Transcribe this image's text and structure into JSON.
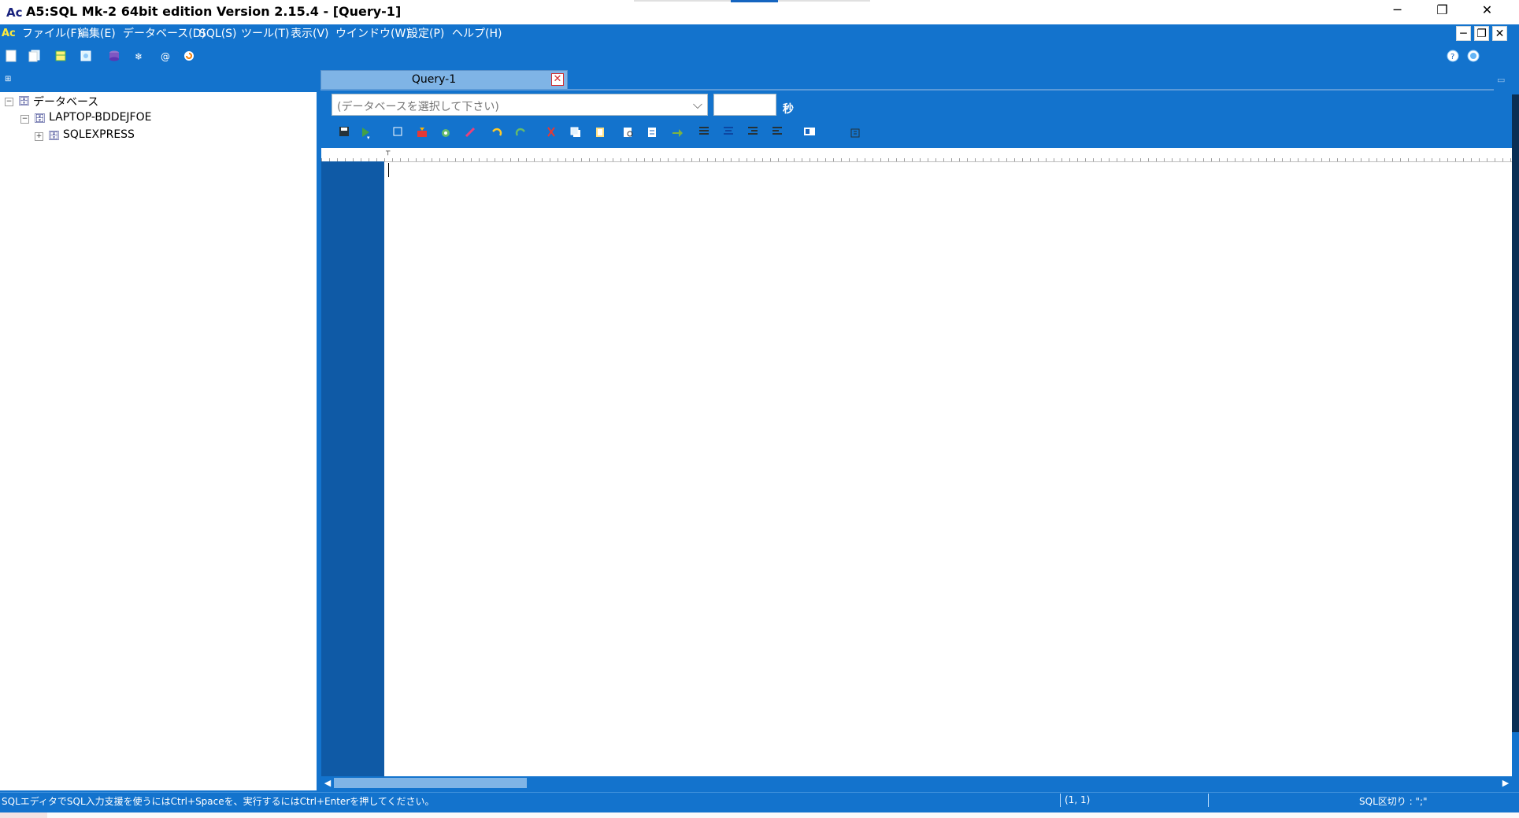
{
  "window": {
    "title": "A5:SQL Mk-2 64bit edition Version 2.15.4 - [Query-1]",
    "app_icon": "Ac",
    "controls": {
      "minimize": "─",
      "maximize": "❐",
      "close": "✕"
    }
  },
  "menu": {
    "items": [
      "ファイル(F)",
      "編集(E)",
      "データベース(D)",
      "SQL(S)",
      "ツール(T)",
      "表示(V)",
      "ウインドウ(W)",
      "設定(P)",
      "ヘルプ(H)"
    ],
    "mdi_controls": {
      "minimize": "─",
      "restore": "❐",
      "close": "✕"
    }
  },
  "toolbar": {
    "icons": [
      "new-file-icon",
      "open-file-icon",
      "table-icon",
      "copy-db-icon",
      "database-icon",
      "snowflake-icon",
      "at-sign-icon",
      "refresh-icon"
    ],
    "help_icons": [
      "help-icon",
      "web-icon"
    ]
  },
  "explorer": {
    "root": {
      "label": "データベース",
      "expander": "−"
    },
    "server": {
      "label": "LAPTOP-BDDEJFOE",
      "expander": "−"
    },
    "instance": {
      "label": "SQLEXPRESS",
      "expander": "+"
    }
  },
  "tabs": [
    {
      "label": "Query-1",
      "close": "✕"
    }
  ],
  "query_bar": {
    "db_placeholder": "(データベースを選択して下さい)",
    "timeout_value": "",
    "seconds_label": "秒"
  },
  "editor_toolbar": {
    "icons": [
      "save-icon",
      "run-icon",
      "stop-icon",
      "explain-icon",
      "format-icon",
      "clear-icon",
      "undo-icon",
      "redo-icon",
      "cut-icon",
      "copy-icon",
      "paste-icon",
      "find-icon",
      "replace-icon",
      "goto-icon",
      "align-left-icon",
      "align-center-icon",
      "indent-icon",
      "outdent-icon",
      "window-icon",
      "options-icon"
    ]
  },
  "statusbar": {
    "message": "SQLエディタでSQL入力支援を使うにはCtrl+Spaceを、実行するにはCtrl+Enterを押してください。",
    "cursor_position": "(1, 1)",
    "sql_delimiter": "SQL区切り : \";\""
  },
  "colors": {
    "workspace": "#1373cd",
    "gutter": "#0f5aa6",
    "tab": "#7fb4e6"
  }
}
